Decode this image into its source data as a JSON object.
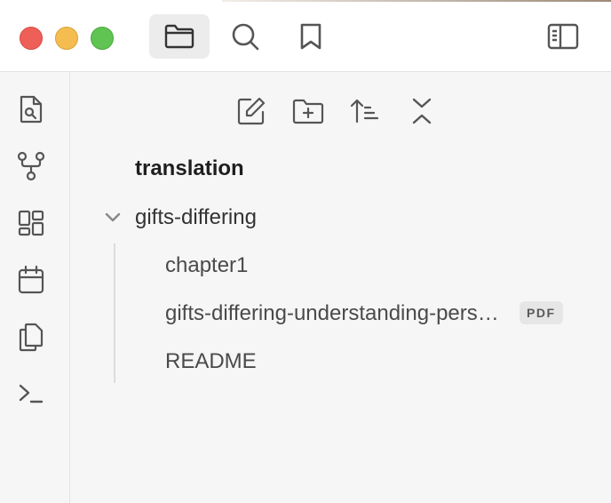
{
  "vault": {
    "name": "translation"
  },
  "folder": {
    "name": "gifts-differing"
  },
  "files": [
    {
      "name": "chapter1"
    },
    {
      "name": "gifts-differing-understanding-personality-type",
      "badge": "PDF"
    },
    {
      "name": "README"
    }
  ],
  "colors": {
    "close": "#ee5f57",
    "minimize": "#f5bd4f",
    "maximize": "#60c453",
    "icon": "#555555"
  },
  "icons": {
    "titlebar": [
      "folder-icon",
      "search-icon",
      "bookmark-icon",
      "sidebar-toggle-icon"
    ],
    "ribbon": [
      "quick-switcher-icon",
      "graph-view-icon",
      "canvas-icon",
      "daily-note-icon",
      "templates-icon",
      "command-palette-icon"
    ],
    "nav": [
      "new-note-icon",
      "new-folder-icon",
      "sort-icon",
      "collapse-all-icon"
    ]
  }
}
